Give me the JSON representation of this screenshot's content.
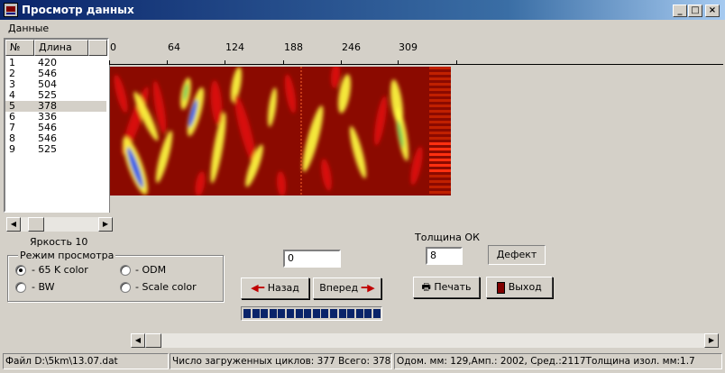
{
  "window": {
    "title": "Просмотр данных",
    "controls": [
      "_",
      "□",
      "×"
    ]
  },
  "menu": {
    "items": [
      "Данные"
    ]
  },
  "list": {
    "columns": [
      "№",
      "Длина"
    ],
    "rows": [
      [
        "1",
        "420"
      ],
      [
        "2",
        "546"
      ],
      [
        "3",
        "504"
      ],
      [
        "4",
        "525"
      ],
      [
        "5",
        "378"
      ],
      [
        "6",
        "336"
      ],
      [
        "7",
        "546"
      ],
      [
        "8",
        "546"
      ],
      [
        "9",
        "525"
      ]
    ],
    "selected_index": 4
  },
  "ruler": {
    "labels": [
      "0",
      "64",
      "124",
      "188",
      "246",
      "309"
    ]
  },
  "brightness": {
    "label": "Яркость 10",
    "value": 10
  },
  "mode_group": {
    "title": "Режим просмотра",
    "options": [
      {
        "label": "- 65 K color",
        "checked": true
      },
      {
        "label": "- ODM",
        "checked": false
      },
      {
        "label": "- BW",
        "checked": false
      },
      {
        "label": "- Scale color",
        "checked": false
      }
    ]
  },
  "position_field": {
    "value": "0"
  },
  "thickness": {
    "label": "Толщина ОК",
    "value": "8"
  },
  "buttons": {
    "defect": "Дефект",
    "back": "Назад",
    "forward": "Вперед",
    "print": "Печать",
    "exit": "Выход"
  },
  "progress": {
    "blocks": 16,
    "fraction": 1.0
  },
  "status": {
    "file": "Файл D:\\5km\\13.07.dat",
    "cycles": "Число загруженных циклов: 377  Всего: 378",
    "measure": "Одом. мм: 129,Амп.: 2002, Сред.:2117Толщина изол. мм:1.7"
  },
  "colors": {
    "title_gradient_start": "#0a246a",
    "heat_low": "#8b0a00",
    "heat_mid": "#e01010",
    "heat_high": "#ffff40",
    "heat_peak": "#2050ff"
  }
}
